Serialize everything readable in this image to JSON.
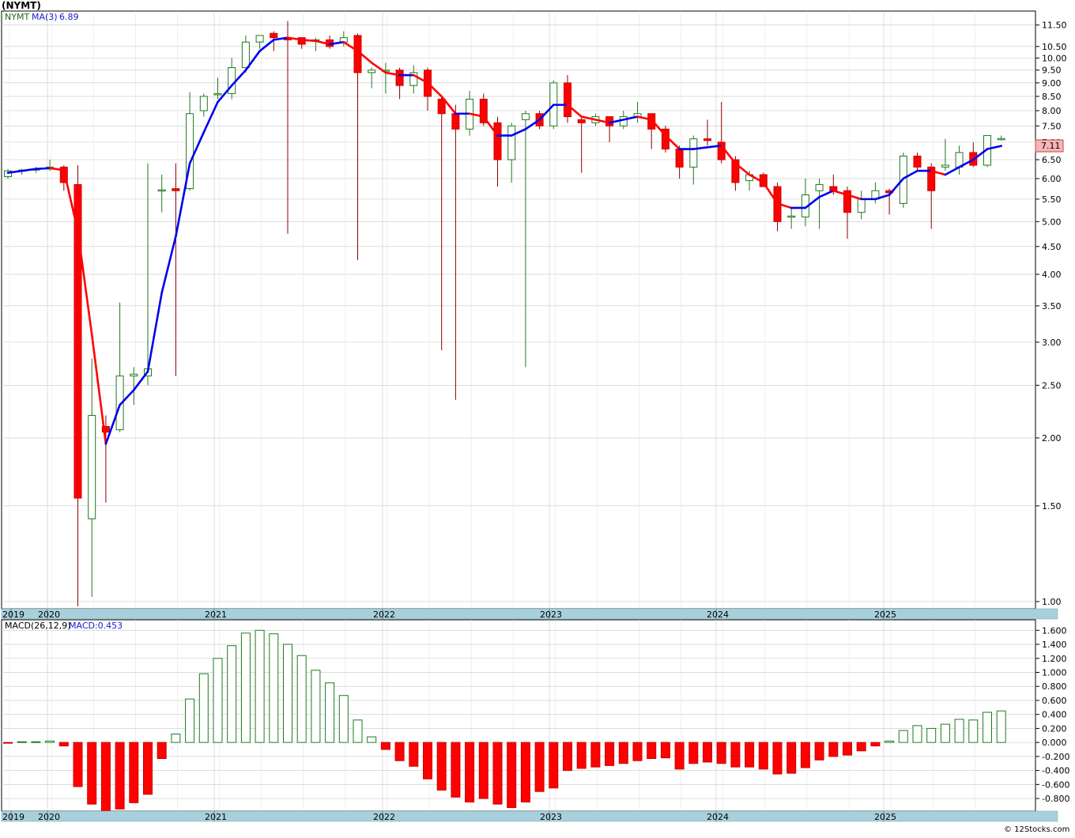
{
  "header": {
    "symbol_title": "(NYMT)",
    "price_legend_symbol": "NYMT",
    "price_legend_ma": "MA(3)",
    "price_legend_ma_value": "6.89",
    "macd_legend_label": "MACD(26,12,9)",
    "macd_legend_value": "MACD:0.453",
    "last_price_badge": "7.11",
    "copyright": "© 12Stocks.com"
  },
  "colors": {
    "up_candle_border": "#1e7a1e",
    "down_candle_fill": "#ff0000",
    "ma_up": "#0000ee",
    "ma_down": "#ff0000",
    "axis_strip": "#a8d0dc",
    "grid": "#c8c8c8",
    "badge": "#f4b6b6"
  },
  "chart_data": [
    {
      "type": "candlestick",
      "title": "",
      "scale": "log",
      "ylim": [
        0.97,
        12.2
      ],
      "y_ticks": [
        "1.00",
        "1.50",
        "2.00",
        "2.50",
        "3.00",
        "3.50",
        "4.00",
        "4.50",
        "5.00",
        "5.50",
        "6.00",
        "6.50",
        "7.00",
        "7.50",
        "8.00",
        "8.50",
        "9.00",
        "9.50",
        "10.00",
        "10.50",
        "11.50"
      ],
      "x_labels": [
        "2019",
        "2020",
        "2021",
        "2022",
        "2023",
        "2024",
        "2025"
      ],
      "x_start": "2019-11",
      "candles": [
        {
          "o": 6.05,
          "h": 6.25,
          "l": 6.0,
          "c": 6.2
        },
        {
          "o": 6.2,
          "h": 6.25,
          "l": 6.1,
          "c": 6.22
        },
        {
          "o": 6.22,
          "h": 6.3,
          "l": 6.15,
          "c": 6.25
        },
        {
          "o": 6.25,
          "h": 6.5,
          "l": 6.2,
          "c": 6.3
        },
        {
          "o": 6.3,
          "h": 6.35,
          "l": 5.7,
          "c": 5.9
        },
        {
          "o": 5.85,
          "h": 6.35,
          "l": 0.98,
          "c": 1.55
        },
        {
          "o": 1.42,
          "h": 2.8,
          "l": 1.02,
          "c": 2.2
        },
        {
          "o": 2.1,
          "h": 2.2,
          "l": 1.52,
          "c": 2.05
        },
        {
          "o": 2.07,
          "h": 3.55,
          "l": 2.05,
          "c": 2.6
        },
        {
          "o": 2.6,
          "h": 2.7,
          "l": 2.3,
          "c": 2.62
        },
        {
          "o": 2.6,
          "h": 6.4,
          "l": 2.5,
          "c": 2.68
        },
        {
          "o": 5.7,
          "h": 6.1,
          "l": 5.2,
          "c": 5.72
        },
        {
          "o": 5.75,
          "h": 6.4,
          "l": 2.6,
          "c": 5.7
        },
        {
          "o": 5.75,
          "h": 8.65,
          "l": 5.7,
          "c": 7.9
        },
        {
          "o": 8.0,
          "h": 8.6,
          "l": 7.8,
          "c": 8.5
        },
        {
          "o": 8.6,
          "h": 9.2,
          "l": 8.4,
          "c": 8.6
        },
        {
          "o": 8.6,
          "h": 10.0,
          "l": 8.4,
          "c": 9.6
        },
        {
          "o": 9.6,
          "h": 11.0,
          "l": 9.4,
          "c": 10.7
        },
        {
          "o": 10.7,
          "h": 11.0,
          "l": 10.4,
          "c": 11.0
        },
        {
          "o": 11.1,
          "h": 11.2,
          "l": 10.3,
          "c": 10.9
        },
        {
          "o": 10.9,
          "h": 11.7,
          "l": 4.75,
          "c": 10.8
        },
        {
          "o": 10.9,
          "h": 10.9,
          "l": 10.4,
          "c": 10.6
        },
        {
          "o": 10.8,
          "h": 10.9,
          "l": 10.3,
          "c": 10.8
        },
        {
          "o": 10.8,
          "h": 11.0,
          "l": 10.4,
          "c": 10.5
        },
        {
          "o": 10.7,
          "h": 11.2,
          "l": 10.5,
          "c": 10.9
        },
        {
          "o": 11.0,
          "h": 11.1,
          "l": 4.25,
          "c": 9.4
        },
        {
          "o": 9.4,
          "h": 9.6,
          "l": 8.8,
          "c": 9.5
        },
        {
          "o": 9.5,
          "h": 9.8,
          "l": 8.6,
          "c": 9.5
        },
        {
          "o": 9.5,
          "h": 9.6,
          "l": 8.4,
          "c": 8.9
        },
        {
          "o": 8.9,
          "h": 9.7,
          "l": 8.6,
          "c": 9.4
        },
        {
          "o": 9.5,
          "h": 9.6,
          "l": 8.0,
          "c": 8.5
        },
        {
          "o": 8.4,
          "h": 8.5,
          "l": 2.9,
          "c": 7.9
        },
        {
          "o": 7.9,
          "h": 8.2,
          "l": 2.35,
          "c": 7.4
        },
        {
          "o": 7.4,
          "h": 8.7,
          "l": 7.2,
          "c": 8.4
        },
        {
          "o": 8.4,
          "h": 8.6,
          "l": 7.5,
          "c": 7.6
        },
        {
          "o": 7.6,
          "h": 7.8,
          "l": 5.8,
          "c": 6.5
        },
        {
          "o": 6.5,
          "h": 7.6,
          "l": 5.9,
          "c": 7.5
        },
        {
          "o": 7.7,
          "h": 8.0,
          "l": 2.7,
          "c": 7.9
        },
        {
          "o": 7.9,
          "h": 8.0,
          "l": 7.4,
          "c": 7.5
        },
        {
          "o": 7.5,
          "h": 9.1,
          "l": 7.4,
          "c": 9.0
        },
        {
          "o": 9.0,
          "h": 9.3,
          "l": 7.6,
          "c": 7.8
        },
        {
          "o": 7.7,
          "h": 7.8,
          "l": 6.15,
          "c": 7.6
        },
        {
          "o": 7.6,
          "h": 7.9,
          "l": 7.5,
          "c": 7.8
        },
        {
          "o": 7.8,
          "h": 7.8,
          "l": 7.0,
          "c": 7.5
        },
        {
          "o": 7.5,
          "h": 8.0,
          "l": 7.4,
          "c": 7.8
        },
        {
          "o": 7.8,
          "h": 8.3,
          "l": 7.6,
          "c": 7.9
        },
        {
          "o": 7.9,
          "h": 7.9,
          "l": 6.8,
          "c": 7.4
        },
        {
          "o": 7.4,
          "h": 7.5,
          "l": 6.7,
          "c": 6.8
        },
        {
          "o": 6.8,
          "h": 6.9,
          "l": 6.0,
          "c": 6.3
        },
        {
          "o": 6.3,
          "h": 7.2,
          "l": 5.85,
          "c": 7.1
        },
        {
          "o": 7.1,
          "h": 7.7,
          "l": 6.9,
          "c": 7.05
        },
        {
          "o": 7.0,
          "h": 8.3,
          "l": 6.4,
          "c": 6.5
        },
        {
          "o": 6.5,
          "h": 6.6,
          "l": 5.7,
          "c": 5.9
        },
        {
          "o": 5.95,
          "h": 6.2,
          "l": 5.7,
          "c": 6.1
        },
        {
          "o": 6.1,
          "h": 6.15,
          "l": 5.8,
          "c": 5.8
        },
        {
          "o": 5.8,
          "h": 5.9,
          "l": 4.8,
          "c": 5.0
        },
        {
          "o": 5.12,
          "h": 5.3,
          "l": 4.85,
          "c": 5.12
        },
        {
          "o": 5.1,
          "h": 6.0,
          "l": 4.9,
          "c": 5.6
        },
        {
          "o": 5.7,
          "h": 6.0,
          "l": 4.85,
          "c": 5.85
        },
        {
          "o": 5.8,
          "h": 6.1,
          "l": 5.6,
          "c": 5.7
        },
        {
          "o": 5.7,
          "h": 5.8,
          "l": 4.65,
          "c": 5.2
        },
        {
          "o": 5.2,
          "h": 5.7,
          "l": 5.05,
          "c": 5.5
        },
        {
          "o": 5.5,
          "h": 5.9,
          "l": 5.4,
          "c": 5.7
        },
        {
          "o": 5.7,
          "h": 5.75,
          "l": 5.15,
          "c": 5.65
        },
        {
          "o": 5.4,
          "h": 6.7,
          "l": 5.3,
          "c": 6.6
        },
        {
          "o": 6.6,
          "h": 6.7,
          "l": 6.2,
          "c": 6.3
        },
        {
          "o": 6.3,
          "h": 6.4,
          "l": 4.85,
          "c": 5.7
        },
        {
          "o": 6.3,
          "h": 7.1,
          "l": 6.2,
          "c": 6.35
        },
        {
          "o": 6.3,
          "h": 6.9,
          "l": 6.1,
          "c": 6.7
        },
        {
          "o": 6.7,
          "h": 7.0,
          "l": 6.3,
          "c": 6.35
        },
        {
          "o": 6.35,
          "h": 7.2,
          "l": 6.3,
          "c": 7.2
        },
        {
          "o": 7.11,
          "h": 7.2,
          "l": 7.05,
          "c": 7.11
        }
      ],
      "ma3": [
        6.15,
        6.2,
        6.25,
        6.27,
        6.22,
        4.8,
        3.1,
        1.95,
        2.3,
        2.45,
        2.65,
        3.7,
        4.7,
        6.4,
        7.3,
        8.3,
        8.9,
        9.5,
        10.3,
        10.8,
        10.9,
        10.8,
        10.75,
        10.6,
        10.7,
        10.3,
        9.8,
        9.4,
        9.3,
        9.3,
        9.0,
        8.5,
        7.9,
        7.9,
        7.8,
        7.2,
        7.2,
        7.4,
        7.7,
        8.2,
        8.2,
        7.8,
        7.7,
        7.6,
        7.7,
        7.8,
        7.7,
        7.2,
        6.8,
        6.8,
        6.85,
        6.9,
        6.4,
        6.1,
        5.9,
        5.4,
        5.3,
        5.3,
        5.55,
        5.7,
        5.6,
        5.5,
        5.5,
        5.6,
        6.0,
        6.2,
        6.2,
        6.1,
        6.3,
        6.5,
        6.8,
        6.89
      ]
    },
    {
      "type": "bar",
      "title": "",
      "ylim": [
        -0.98,
        1.75
      ],
      "y_ticks": [
        "1.600",
        "1.400",
        "1.200",
        "1.000",
        "0.800",
        "0.600",
        "0.400",
        "0.200",
        "0.000",
        "-0.200",
        "-0.400",
        "-0.600",
        "-0.800"
      ],
      "x_labels": [
        "2019",
        "2020",
        "2021",
        "2022",
        "2023",
        "2024",
        "2025"
      ],
      "values": [
        -0.01,
        0.01,
        0.01,
        0.02,
        -0.05,
        -0.63,
        -0.88,
        -0.98,
        -0.95,
        -0.86,
        -0.74,
        -0.23,
        0.12,
        0.62,
        0.98,
        1.2,
        1.38,
        1.56,
        1.6,
        1.55,
        1.4,
        1.24,
        1.03,
        0.85,
        0.67,
        0.32,
        0.08,
        -0.1,
        -0.26,
        -0.34,
        -0.52,
        -0.68,
        -0.78,
        -0.85,
        -0.8,
        -0.88,
        -0.93,
        -0.85,
        -0.7,
        -0.65,
        -0.4,
        -0.37,
        -0.35,
        -0.33,
        -0.3,
        -0.26,
        -0.23,
        -0.22,
        -0.38,
        -0.3,
        -0.28,
        -0.3,
        -0.35,
        -0.35,
        -0.38,
        -0.45,
        -0.44,
        -0.36,
        -0.25,
        -0.2,
        -0.18,
        -0.12,
        -0.05,
        0.02,
        0.17,
        0.24,
        0.2,
        0.26,
        0.33,
        0.32,
        0.43,
        0.45
      ]
    }
  ]
}
